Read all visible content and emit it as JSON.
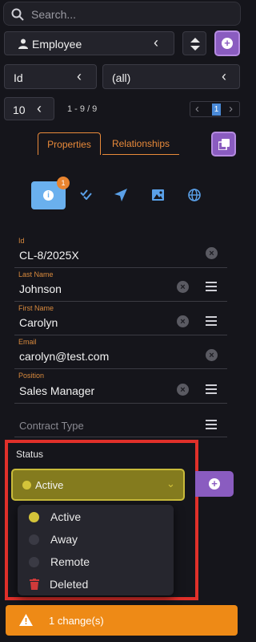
{
  "search": {
    "placeholder": "Search..."
  },
  "entity_select": {
    "value": "Employee",
    "icon": "person-icon"
  },
  "filter": {
    "field": "Id",
    "value": "(all)"
  },
  "paging": {
    "page_size": "10",
    "range": "1 - 9 / 9",
    "current_page": "1"
  },
  "tabs": [
    {
      "label": "Properties",
      "active": true
    },
    {
      "label": "Relationships",
      "active": false
    }
  ],
  "toolbar_badge": "1",
  "fields": [
    {
      "label": "Id",
      "value": "CL-8/2025X"
    },
    {
      "label": "Last Name",
      "value": "Johnson"
    },
    {
      "label": "First Name",
      "value": "Carolyn"
    },
    {
      "label": "Email",
      "value": "carolyn@test.com"
    },
    {
      "label": "Position",
      "value": "Sales Manager"
    },
    {
      "label": "",
      "value": "",
      "placeholder": "Contract Type"
    }
  ],
  "status": {
    "label": "Status",
    "selected": "Active",
    "options": [
      {
        "label": "Active",
        "color": "#d4c43a"
      },
      {
        "label": "Away",
        "color": "#3a3a44"
      },
      {
        "label": "Remote",
        "color": "#3a3a44"
      },
      {
        "label": "Deleted",
        "color": "#d03a3a",
        "icon": "trash-icon"
      }
    ]
  },
  "footer": {
    "changes": "1 change(s)"
  },
  "colors": {
    "accent": "#e98a3a",
    "purple": "#8a5cc0",
    "blue": "#5aa0e8",
    "highlight": "#e0302a"
  }
}
